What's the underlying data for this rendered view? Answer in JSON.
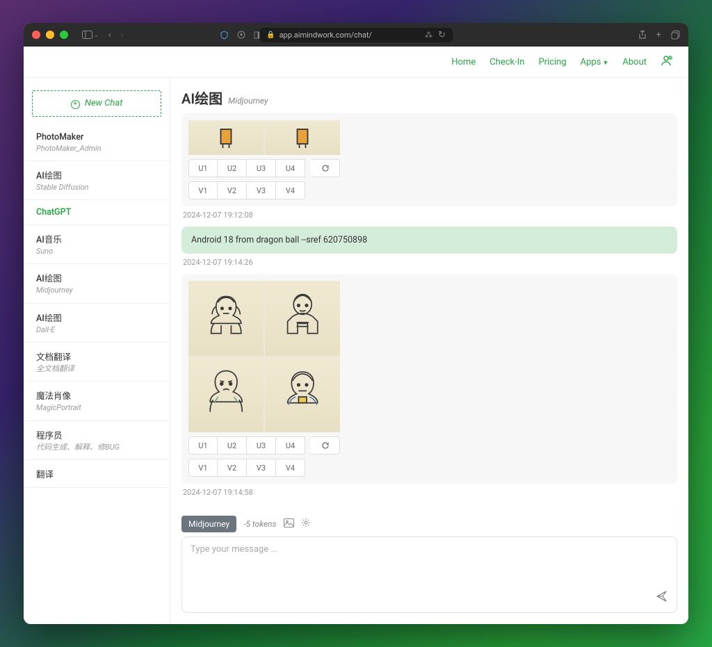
{
  "browser": {
    "url": "app.aimindwork.com/chat/"
  },
  "nav": {
    "items": [
      "Home",
      "Check-In",
      "Pricing",
      "Apps",
      "About"
    ]
  },
  "sidebar": {
    "new_chat": "New Chat",
    "items": [
      {
        "title": "PhotoMaker",
        "sub": "PhotoMaker_Admin"
      },
      {
        "title": "AI绘图",
        "sub": "Stable Diffusion"
      },
      {
        "title": "ChatGPT",
        "sub": ""
      },
      {
        "title": "AI音乐",
        "sub": "Suno"
      },
      {
        "title": "AI绘图",
        "sub": "Midjourney"
      },
      {
        "title": "AI绘图",
        "sub": "Dall-E"
      },
      {
        "title": "文档翻译",
        "sub": "全文档翻译"
      },
      {
        "title": "魔法肖像",
        "sub": "MagicPortrait"
      },
      {
        "title": "程序员",
        "sub": "代码生成、解释、修BUG"
      },
      {
        "title": "翻译",
        "sub": ""
      }
    ],
    "active_index": 2
  },
  "header": {
    "title": "AI绘图",
    "sub": "Midjourney"
  },
  "chat": {
    "buttons_u": [
      "U1",
      "U2",
      "U3",
      "U4"
    ],
    "buttons_v": [
      "V1",
      "V2",
      "V3",
      "V4"
    ],
    "msg1_timestamp": "2024-12-07 19:12:08",
    "prompt_text": "Android 18 from dragon ball --sref 620750898",
    "prompt_timestamp": "2024-12-07 19:14:26",
    "msg2_timestamp": "2024-12-07 19:14:58"
  },
  "composer": {
    "badge": "Midjourney",
    "tokens": "-5 tokens",
    "placeholder": "Type your message ..."
  }
}
